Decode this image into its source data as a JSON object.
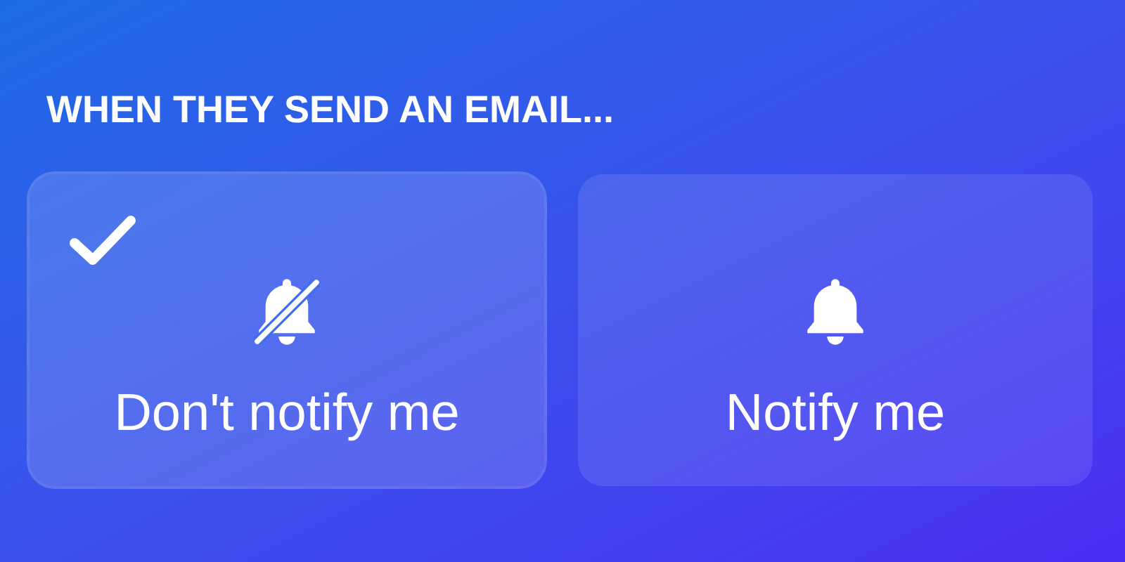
{
  "heading": "WHEN THEY SEND AN EMAIL...",
  "options": [
    {
      "label": "Don't notify me",
      "kind": "bell-off",
      "selected": true
    },
    {
      "label": "Notify me",
      "kind": "bell",
      "selected": false
    }
  ]
}
